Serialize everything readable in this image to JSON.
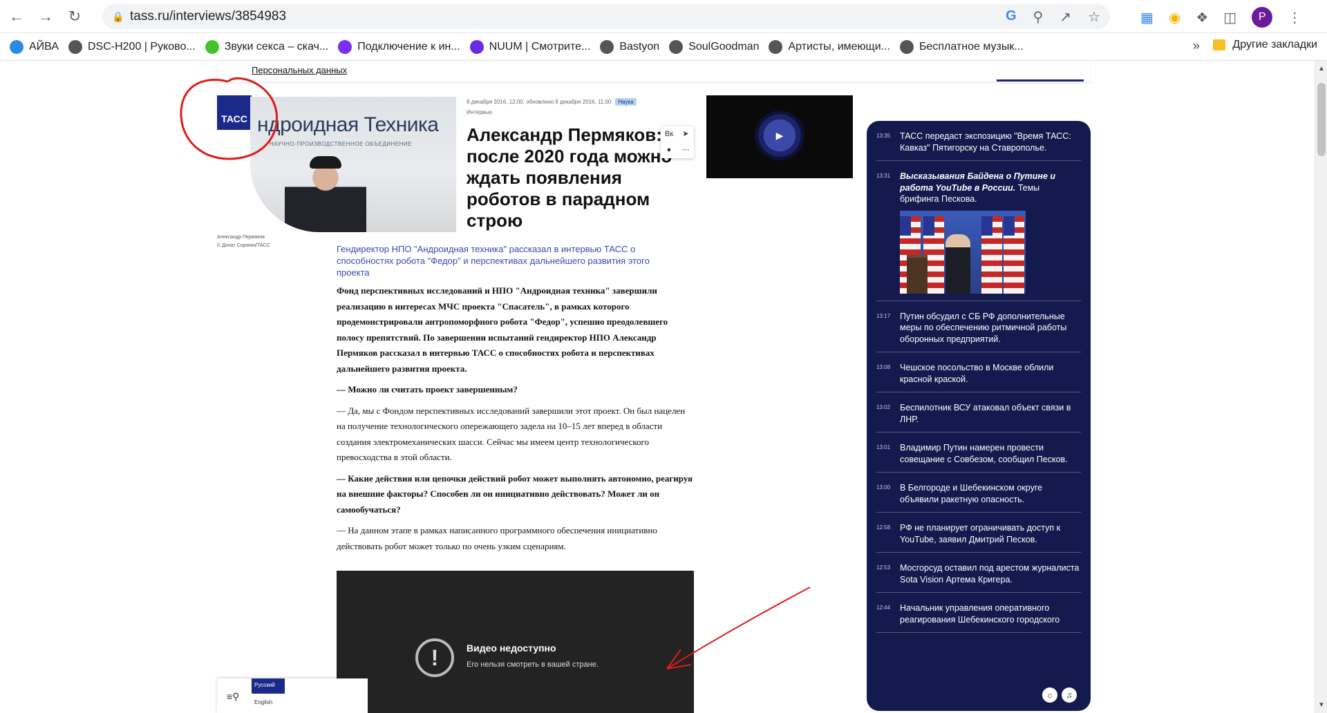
{
  "browser": {
    "url": "tass.ru/interviews/3854983",
    "avatar_letter": "P",
    "bookmarks": [
      {
        "label": "АЙВА",
        "icon": "aiva-icon",
        "color": "#2a8be0"
      },
      {
        "label": "DSC-H200 | Руково...",
        "icon": "globe-icon",
        "color": "#555555"
      },
      {
        "label": "Звуки секса – скач...",
        "icon": "play-icon",
        "color": "#43c32b"
      },
      {
        "label": "Подключение к ин...",
        "icon": "bookmark-icon",
        "color": "#7b2ff7"
      },
      {
        "label": "NUUM | Смотрите...",
        "icon": "nuum-icon",
        "color": "#6a2ce0"
      },
      {
        "label": "Bastyon",
        "icon": "globe-icon",
        "color": "#555555"
      },
      {
        "label": "SoulGoodman",
        "icon": "globe-icon",
        "color": "#555555"
      },
      {
        "label": "Артисты, имеющи...",
        "icon": "globe-icon",
        "color": "#555555"
      },
      {
        "label": "Бесплатное музык...",
        "icon": "music-icon",
        "color": "#555555"
      }
    ],
    "more_label": "»",
    "other_bookmarks": "Другие закладки"
  },
  "page": {
    "personal_data_link": "Персональных данных",
    "logo": "ТАСС",
    "hero_brand": "ндроидная Техника",
    "hero_sub": "НАУЧНО-ПРОИЗВОДСТВЕННОЕ ОБЪЕДИНЕНИЕ",
    "photo_caption_1": "Александр Пермяков",
    "photo_caption_2": "© Донат Сорокин/ТАСС",
    "meta_date": "9 декабря 2016, 12:00, обновлено 9 декабря 2016, 11:00",
    "meta_tag": "Наука",
    "rubric": "Интервью",
    "title": "Александр Пермяков: после 2020 года можно ждать появления роботов в парадном строю",
    "lead": "Гендиректор НПО \"Андроидная техника\" рассказал в интервью ТАСС о способностях робота \"Федор\" и перспективах дальнейшего развития этого проекта",
    "paragraphs": [
      {
        "text": "Фонд перспективных исследований и НПО \"Андроидная техника\" завершили реализацию в интересах МЧС проекта \"Спасатель\", в рамках которого продемонстрировали антропоморфного робота \"Федор\", успешно преодолевшего полосу препятствий. По завершении испытаний гендиректор НПО Александр Пермяков рассказал в интервью ТАСС о способностях робота и перспективах дальнейшего развития проекта.",
        "bold": true
      },
      {
        "text": "— Можно ли считать проект завершенным?",
        "bold": true
      },
      {
        "text": "— Да, мы с Фондом перспективных исследований завершили этот проект. Он был нацелен на получение технологического опережающего задела на 10–15 лет вперед в области создания электромеханических шасси. Сейчас мы имеем центр технологического превосходства в этой области.",
        "bold": false
      },
      {
        "text": "— Какие действия или цепочки действий робот может выполнять автономно, реагируя на внешние факторы? Способен ли он инициативно действовать? Может ли он самообучаться?",
        "bold": true
      },
      {
        "text": "— На данном этапе в рамках написанного программного обеспечения инициативно действовать робот может только по очень узким сценариям.",
        "bold": false
      }
    ],
    "video_title": "Видео недоступно",
    "video_sub": "Его нельзя смотреть в вашей стране.",
    "lang_ru": "Русский",
    "lang_en": "English"
  },
  "feed": [
    {
      "time": "13:35",
      "text": "ТАСС передаст экспозицию \"Время ТАСС: Кавказ\" Пятигорску на Ставрополье.",
      "bold": ""
    },
    {
      "time": "13:31",
      "bold": "Высказывания Байдена о Путине и работа YouTube в России.",
      "text": " Темы брифинга Пескова.",
      "image": true
    },
    {
      "time": "13:17",
      "text": "Путин обсудил с СБ РФ дополнительные меры по обеспечению ритмичной работы оборонных предприятий.",
      "bold": ""
    },
    {
      "time": "13:08",
      "text": "Чешское посольство в Москве облили красной краской.",
      "bold": ""
    },
    {
      "time": "13:02",
      "text": "Беспилотник ВСУ атаковал объект связи в ЛНР.",
      "bold": ""
    },
    {
      "time": "13:01",
      "text": "Владимир Путин намерен провести совещание с Совбезом, сообщил Песков.",
      "bold": ""
    },
    {
      "time": "13:00",
      "text": "В Белгороде и Шебекинском округе объявили ракетную опасность.",
      "bold": ""
    },
    {
      "time": "12:58",
      "text": "РФ не планирует ограничивать доступ к YouTube, заявил Дмитрий Песков.",
      "bold": ""
    },
    {
      "time": "12:53",
      "text": "Мосгорсуд оставил под арестом журналиста Sota Vision Артема Кригера.",
      "bold": ""
    },
    {
      "time": "12:44",
      "text": "Начальник управления оперативного реагирования Шебекинского городского",
      "bold": ""
    }
  ],
  "colors": {
    "annotation": "#e01b1b",
    "feed_bg": "#141a4e",
    "tass_blue": "#1b2a8a"
  }
}
